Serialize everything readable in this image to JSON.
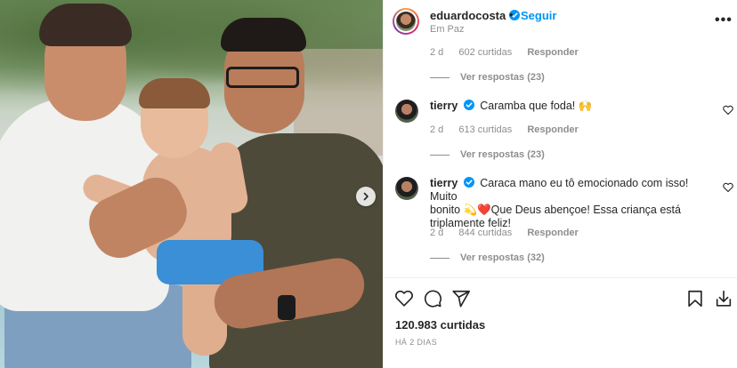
{
  "post": {
    "username": "eduardocosta",
    "follow_label": "Seguir",
    "separator": "•",
    "location": "Em Paz",
    "more_label": "•••"
  },
  "comments": [
    {
      "meta": {
        "time": "2 d",
        "likes": "602 curtidas",
        "reply": "Responder"
      },
      "view_replies": "Ver respostas (23)"
    },
    {
      "username": "tierry",
      "text": "Caramba que foda! 🙌",
      "meta": {
        "time": "2 d",
        "likes": "613 curtidas",
        "reply": "Responder"
      },
      "view_replies": "Ver respostas (23)"
    },
    {
      "username": "tierry",
      "text_line1": "Caraca mano eu tô emocionado com isso! Muito",
      "text_line2": "bonito 💫❤️Que Deus abençoe! Essa criança está",
      "text_line3": "triplamente feliz!",
      "meta": {
        "time": "2 d",
        "likes": "844 curtidas",
        "reply": "Responder"
      },
      "view_replies": "Ver respostas (32)"
    }
  ],
  "footer": {
    "likes": "120.983 curtidas",
    "time_ago": "HÁ 2 DIAS"
  },
  "icons": {
    "verified": "verified-badge-icon",
    "like": "heart-icon",
    "comment": "comment-icon",
    "share": "paper-plane-icon",
    "save": "bookmark-icon",
    "download": "download-icon",
    "next": "chevron-right-icon"
  },
  "colors": {
    "link": "#0095f6",
    "muted": "#8e8e8e",
    "text": "#262626"
  }
}
